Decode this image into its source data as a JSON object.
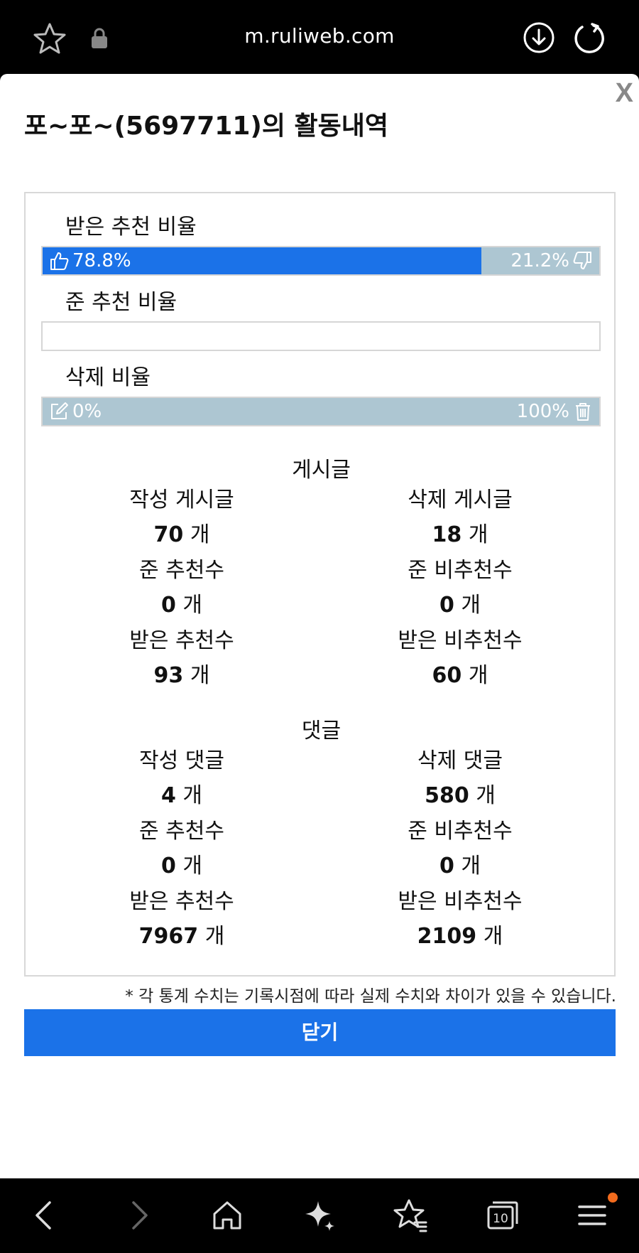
{
  "browser": {
    "url": "m.ruliweb.com",
    "icons": [
      "star-icon",
      "lock-icon",
      "download-icon",
      "reload-icon"
    ]
  },
  "modal": {
    "close_label": "X",
    "title": "포~포~(5697711)의 활동내역",
    "received_ratio": {
      "label": "받은 추천 비율",
      "up_pct": "78.8%",
      "down_pct": "21.2%",
      "up_value": 78.8
    },
    "given_ratio": {
      "label": "준 추천 비율"
    },
    "delete_ratio": {
      "label": "삭제 비율",
      "kept_pct": "0%",
      "deleted_pct": "100%",
      "kept_value": 0
    },
    "posts": {
      "header": "게시글",
      "stats": [
        {
          "label": "작성 게시글",
          "value": "70",
          "unit": "개"
        },
        {
          "label": "삭제 게시글",
          "value": "18",
          "unit": "개"
        },
        {
          "label": "준 추천수",
          "value": "0",
          "unit": "개"
        },
        {
          "label": "준 비추천수",
          "value": "0",
          "unit": "개"
        },
        {
          "label": "받은 추천수",
          "value": "93",
          "unit": "개"
        },
        {
          "label": "받은 비추천수",
          "value": "60",
          "unit": "개"
        }
      ]
    },
    "comments": {
      "header": "댓글",
      "stats": [
        {
          "label": "작성 댓글",
          "value": "4",
          "unit": "개"
        },
        {
          "label": "삭제 댓글",
          "value": "580",
          "unit": "개"
        },
        {
          "label": "준 추천수",
          "value": "0",
          "unit": "개"
        },
        {
          "label": "준 비추천수",
          "value": "0",
          "unit": "개"
        },
        {
          "label": "받은 추천수",
          "value": "7967",
          "unit": "개"
        },
        {
          "label": "받은 비추천수",
          "value": "2109",
          "unit": "개"
        }
      ]
    },
    "note": "* 각 통계 수치는 기록시점에 따라 실제 수치와 차이가 있을 수 있습니다.",
    "close_button": "닫기"
  },
  "bottom_nav": {
    "tab_count": "10",
    "icons": [
      "back-icon",
      "forward-icon",
      "home-icon",
      "sparkle-icon",
      "bookmarks-icon",
      "tabs-icon",
      "menu-icon"
    ]
  },
  "colors": {
    "accent": "#1b72e8",
    "bar_gray": "#adc6d2"
  }
}
